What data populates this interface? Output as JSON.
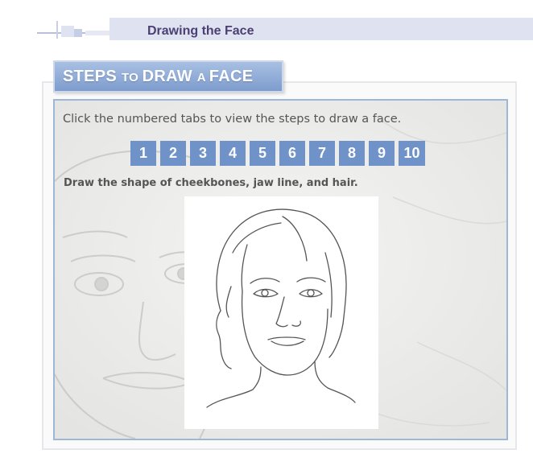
{
  "header": {
    "title": "Drawing the Face"
  },
  "section": {
    "title_part1": "STEPS ",
    "title_part2": "TO ",
    "title_part3": "DRAW ",
    "title_part4": "A ",
    "title_part5": "FACE",
    "instruction": "Click the numbered tabs to view the steps to draw a face."
  },
  "tabs": [
    "1",
    "2",
    "3",
    "4",
    "5",
    "6",
    "7",
    "8",
    "9",
    "10"
  ],
  "current_step": {
    "caption": "Draw the shape of cheekbones, jaw line, and hair."
  },
  "colors": {
    "tab_blue": "#6f92c9",
    "panel_border": "#9fb7d7",
    "header_band": "#dfe2f1",
    "header_text": "#4b3f73"
  }
}
